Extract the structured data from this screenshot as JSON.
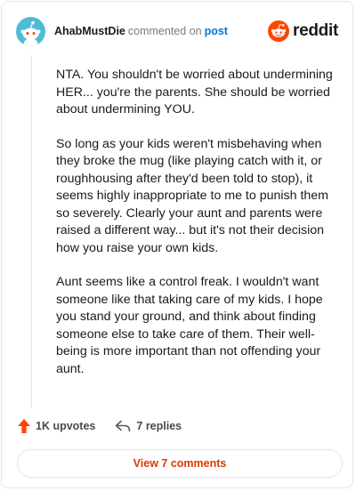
{
  "header": {
    "username": "AhabMustDie",
    "action_text": "commented on",
    "post_link": "post",
    "brand": "reddit",
    "icons": {
      "avatar": "snoo-avatar",
      "brand_logo": "reddit-logo-icon"
    }
  },
  "comment": {
    "paragraphs": [
      "NTA. You shouldn't be worried about undermining HER... you're the parents. She should be worried about undermining YOU.",
      "So long as your kids weren't misbehaving when they broke the mug (like playing catch with it, or roughhousing after they'd been told to stop), it seems highly inappropriate to me to punish them so severely. Clearly your aunt and parents were raised a different way... but it's not their decision how you raise your own kids.",
      "Aunt seems like a control freak. I wouldn't want someone like that taking care of my kids. I hope you stand your ground, and think about finding someone else to take care of them. Their well-being is more important than not offending your aunt."
    ]
  },
  "actions": {
    "upvotes_label": "1K upvotes",
    "replies_label": "7 replies",
    "icons": {
      "upvote": "upvote-arrow-icon",
      "reply": "reply-arrow-icon"
    }
  },
  "footer": {
    "view_comments_label": "View 7 comments"
  },
  "colors": {
    "accent": "#d93a00",
    "link": "#0079d3",
    "reddit_orange": "#ff4500",
    "avatar_bg": "#4fbcd6"
  }
}
